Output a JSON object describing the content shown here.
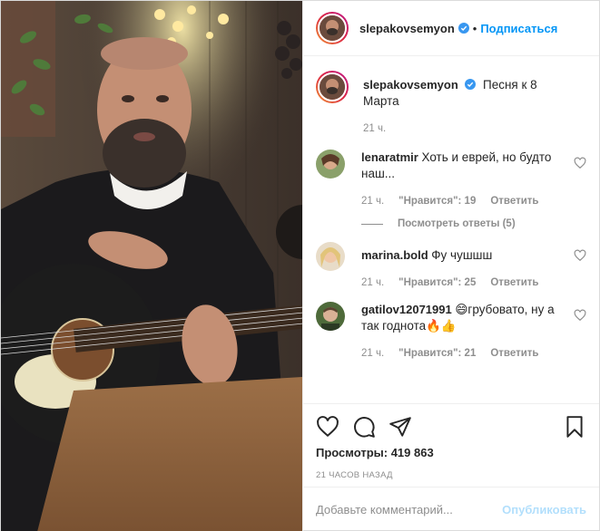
{
  "post": {
    "author": {
      "username": "slepakovsemyon",
      "verified": true,
      "follow_label": "Подписаться",
      "dot": "•"
    },
    "caption": {
      "username": "slepakovsemyon",
      "text": "Песня к 8 Марта",
      "time": "21 ч."
    },
    "comments": [
      {
        "username": "lenaratmir",
        "text": "Хоть и еврей, но будто наш...",
        "time": "21 ч.",
        "likes": "\"Нравится\": 19",
        "reply": "Ответить",
        "view_replies": "Посмотреть ответы (5)"
      },
      {
        "username": "marina.bold",
        "text": "Фу чушшш",
        "time": "21 ч.",
        "likes": "\"Нравится\": 25",
        "reply": "Ответить"
      },
      {
        "username": "gatilov12071991",
        "text": "😄грубовато, ну а так годнота🔥👍",
        "time": "21 ч.",
        "likes": "\"Нравится\": 21",
        "reply": "Ответить"
      }
    ],
    "views_label": "Просмотры:",
    "views_value": "419 863",
    "posted_ago": "21 ЧАСОВ НАЗАД",
    "comment_input": {
      "placeholder": "Добавьте комментарий...",
      "publish_label": "Опубликовать"
    },
    "icons": [
      "heart-icon",
      "comment-icon",
      "share-icon",
      "bookmark-icon"
    ],
    "colors": {
      "accent": "#0095f6",
      "publish_disabled": "#b2dffc",
      "muted": "#8e8e8e",
      "text": "#262626"
    }
  }
}
